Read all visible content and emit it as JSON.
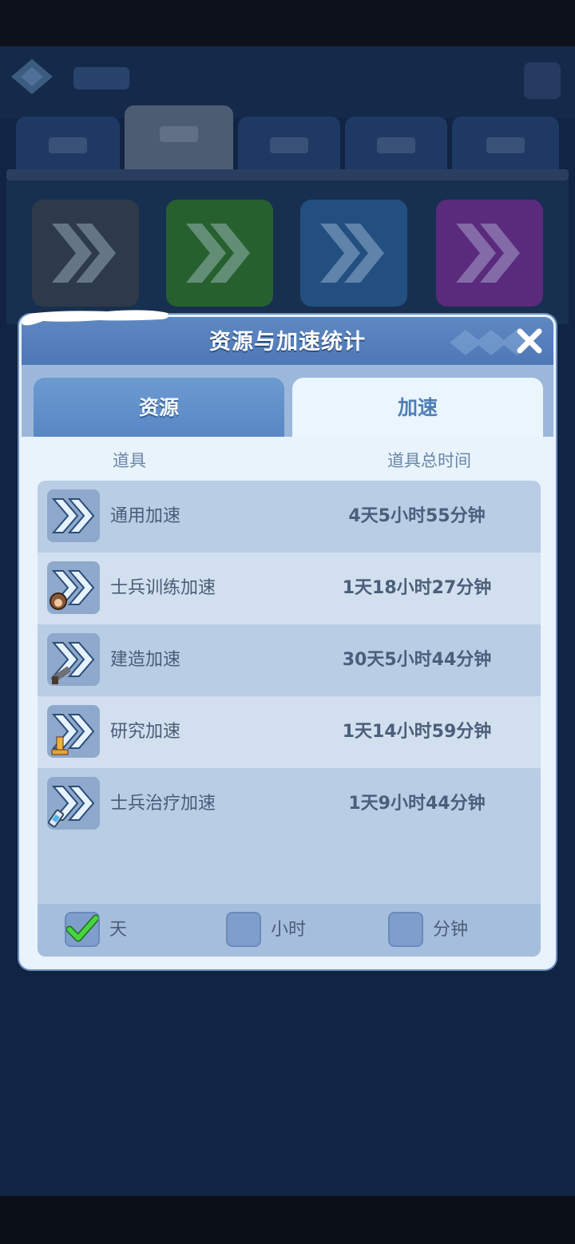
{
  "dialog": {
    "title": "资源与加速统计",
    "tabs": {
      "resources": "资源",
      "speedups": "加速"
    },
    "active_tab": "speedups",
    "columns": {
      "item": "道具",
      "total_time": "道具总时间"
    },
    "rows": [
      {
        "name": "通用加速",
        "time": "4天5小时55分钟",
        "icon": "speedup-general-icon"
      },
      {
        "name": "士兵训练加速",
        "time": "1天18小时27分钟",
        "icon": "speedup-training-icon"
      },
      {
        "name": "建造加速",
        "time": "30天5小时44分钟",
        "icon": "speedup-building-icon"
      },
      {
        "name": "研究加速",
        "time": "1天14小时59分钟",
        "icon": "speedup-research-icon"
      },
      {
        "name": "士兵治疗加速",
        "time": "1天9小时44分钟",
        "icon": "speedup-healing-icon"
      }
    ],
    "units": [
      {
        "label": "天",
        "checked": true
      },
      {
        "label": "小时",
        "checked": false
      },
      {
        "label": "分钟",
        "checked": false
      }
    ]
  },
  "colors": {
    "header": "#5f88c2",
    "body": "#e8f3fb",
    "row_dark": "#b9cde5",
    "row_light": "#d2dfee",
    "check": "#3fbf3a"
  }
}
